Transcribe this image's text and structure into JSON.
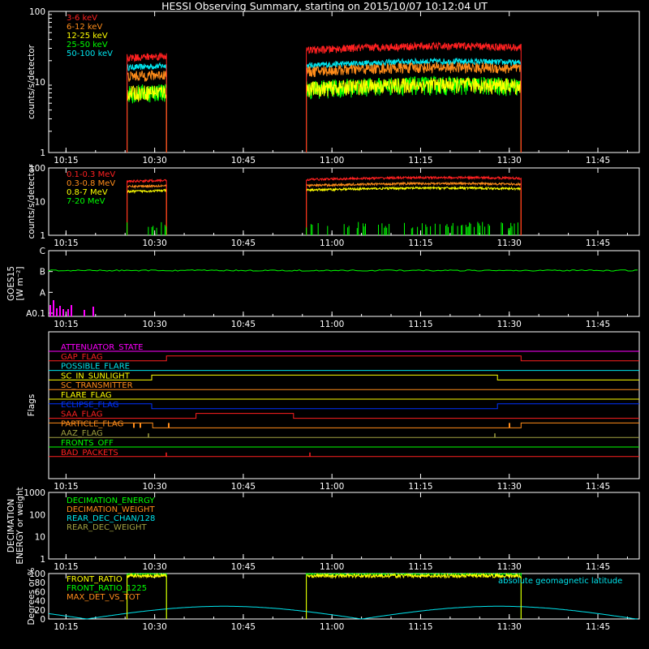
{
  "title": "HESSI Observing Summary, starting on 2015/10/07 10:12:04 UT",
  "colors": {
    "background": "#000000",
    "axis": "#ffffff",
    "red": "#ff2020",
    "orange": "#ff8c1a",
    "yellow": "#ffff00",
    "green": "#00ff00",
    "cyan": "#00e5ee",
    "magenta": "#ff00ff",
    "blue": "#0033ff",
    "olive": "#a0a040"
  },
  "time_axis": {
    "start": "10:12:04",
    "end": "11:52:00",
    "ticks": [
      "10:15",
      "10:30",
      "10:45",
      "11:00",
      "11:15",
      "11:30",
      "11:45"
    ]
  },
  "observing_intervals": [
    [
      "10:25:20",
      "10:32:00"
    ],
    [
      "10:55:40",
      "11:32:00"
    ]
  ],
  "chart_data": [
    {
      "id": "lowE",
      "type": "line",
      "ylabel": "counts/s/detector",
      "yscale": "log",
      "ylim": [
        1,
        100
      ],
      "yticks": [
        "1",
        "10",
        "100"
      ],
      "series": [
        {
          "name": "3-6 keV",
          "color": "red",
          "level": [
            22,
            28
          ]
        },
        {
          "name": "6-12 keV",
          "color": "orange",
          "level": [
            12,
            14
          ]
        },
        {
          "name": "12-25 keV",
          "color": "yellow",
          "level": [
            7,
            8
          ]
        },
        {
          "name": "25-50 keV",
          "color": "green",
          "level": [
            7,
            8
          ]
        },
        {
          "name": "50-100 keV",
          "color": "cyan",
          "level": [
            16,
            17
          ]
        }
      ]
    },
    {
      "id": "highE",
      "type": "line",
      "ylabel": "counts/s/detector",
      "yscale": "log",
      "ylim": [
        1,
        100
      ],
      "yticks": [
        "1",
        "10",
        "100"
      ],
      "series": [
        {
          "name": "0.1-0.3 MeV",
          "color": "red",
          "level": [
            40,
            45
          ]
        },
        {
          "name": "0.3-0.8 MeV",
          "color": "orange",
          "level": [
            28,
            30
          ]
        },
        {
          "name": "0.8-7 MeV",
          "color": "yellow",
          "level": [
            20,
            22
          ]
        },
        {
          "name": "7-20 MeV",
          "color": "green",
          "level": [
            1.7,
            2.5
          ]
        }
      ]
    },
    {
      "id": "goes",
      "type": "line",
      "ylabel": "GOES15",
      "ylabel2": "[W m⁻²]",
      "yticks": [
        "A0.1",
        "A",
        "B",
        "C"
      ],
      "level_index": 2.05
    },
    {
      "id": "flags",
      "type": "line",
      "ylabel": "Flags",
      "flags": [
        {
          "name": "ATTENUATOR_STATE",
          "color": "magenta",
          "steps": [],
          "base": 0
        },
        {
          "name": "GAP_FLAG",
          "color": "red",
          "steps": [
            [
              "10:12:04",
              "10:32:00",
              0
            ],
            [
              "10:32:00",
              "11:32:00",
              1
            ],
            [
              "11:32:00",
              "11:52:00",
              0
            ]
          ]
        },
        {
          "name": "POSSIBLE_FLARE",
          "color": "cyan",
          "steps": [],
          "base": 0
        },
        {
          "name": "SC_IN_SUNLIGHT",
          "color": "yellow",
          "steps": [
            [
              "10:12:04",
              "10:29:30",
              0
            ],
            [
              "10:29:30",
              "11:28:00",
              1
            ],
            [
              "11:28:00",
              "11:52:00",
              0
            ]
          ]
        },
        {
          "name": "SC_TRANSMITTER",
          "color": "orange",
          "steps": [],
          "base": 0
        },
        {
          "name": "FLARE_FLAG",
          "color": "yellow",
          "steps": [],
          "base": 0
        },
        {
          "name": "ECLIPSE_FLAG",
          "color": "blue",
          "steps": [
            [
              "10:12:04",
              "10:29:30",
              1
            ],
            [
              "10:29:30",
              "11:28:00",
              0
            ],
            [
              "11:28:00",
              "11:52:00",
              1
            ]
          ]
        },
        {
          "name": "SAA_FLAG",
          "color": "red",
          "steps": [
            [
              "10:12:04",
              "10:37:00",
              0
            ],
            [
              "10:37:00",
              "10:53:30",
              1
            ],
            [
              "10:53:30",
              "11:52:00",
              0
            ]
          ]
        },
        {
          "name": "PARTICLE_FLAG",
          "color": "orange",
          "steps": [
            [
              "10:12:04",
              "10:29:40",
              1
            ],
            [
              "10:29:40",
              "11:32:00",
              0
            ],
            [
              "11:32:00",
              "11:52:00",
              1
            ]
          ]
        },
        {
          "name": "AAZ_FLAG",
          "color": "olive",
          "steps": [],
          "base": 0
        },
        {
          "name": "FRONTS_OFF",
          "color": "green",
          "steps": [],
          "base": 0
        },
        {
          "name": "BAD_PACKETS",
          "color": "red",
          "steps": [],
          "base": 0
        }
      ]
    },
    {
      "id": "decim",
      "type": "line",
      "ylabel": "DECIMATION",
      "ylabel2": "ENERGY or weight",
      "yscale": "log",
      "ylim": [
        1,
        1000
      ],
      "yticks": [
        "1",
        "10",
        "100",
        "1000"
      ],
      "series": [
        {
          "name": "DECIMATION_ENERGY",
          "color": "green"
        },
        {
          "name": "DECIMATION_WEIGHT",
          "color": "orange"
        },
        {
          "name": "REAR_DEC_CHAN/128",
          "color": "cyan"
        },
        {
          "name": "REAR_DEC_WEIGHT",
          "color": "olive"
        }
      ]
    },
    {
      "id": "ratio",
      "type": "line",
      "ylabel": "Degrees or %",
      "ylim": [
        0,
        100
      ],
      "yticks": [
        "0",
        "20",
        "40",
        "60",
        "80",
        "100"
      ],
      "series": [
        {
          "name": "FRONT_RATIO",
          "color": "yellow",
          "level": 95
        },
        {
          "name": "FRONT_RATIO_1225",
          "color": "green",
          "level": 99
        },
        {
          "name": "MAX_DET_VS_TOT",
          "color": "orange"
        }
      ],
      "annotation": "absolute geomagnetic latitude",
      "latitude": {
        "amplitude": 28,
        "period_minutes": 46.5,
        "zero_at": "10:18:30"
      }
    }
  ]
}
